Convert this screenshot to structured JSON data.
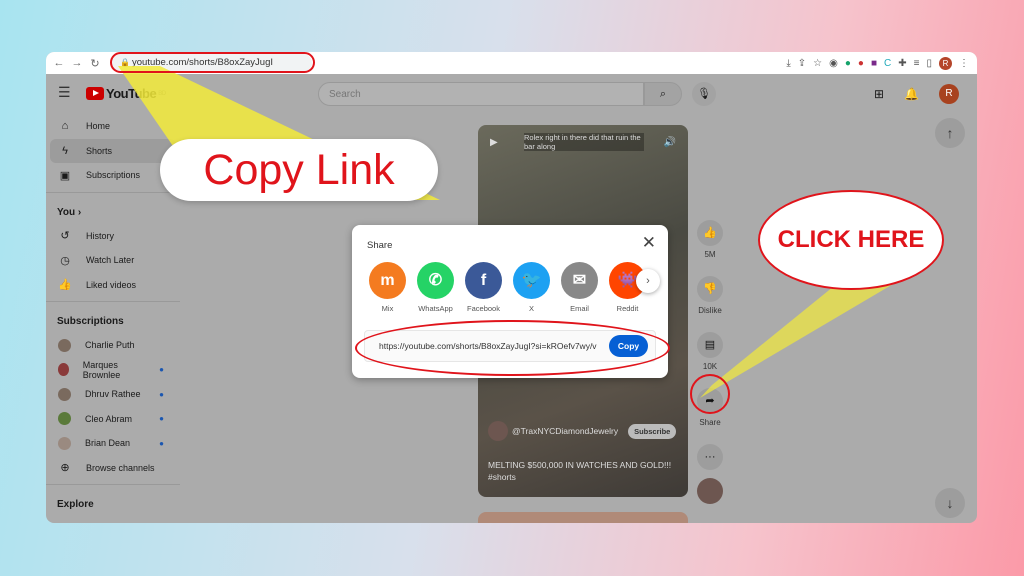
{
  "browser": {
    "url": "youtube.com/shorts/B8oxZayJugI",
    "profile_initial": "R"
  },
  "youtube": {
    "logo": "YouTube",
    "region": "BD",
    "search_placeholder": "Search",
    "avatar_initial": "R",
    "sidebar": {
      "main": [
        {
          "label": "Home",
          "icon": "home-icon"
        },
        {
          "label": "Shorts",
          "icon": "shorts-icon"
        },
        {
          "label": "Subscriptions",
          "icon": "subscriptions-icon"
        }
      ],
      "you_heading": "You",
      "you": [
        {
          "label": "History"
        },
        {
          "label": "Watch Later"
        },
        {
          "label": "Liked videos"
        }
      ],
      "subscriptions_heading": "Subscriptions",
      "subscriptions": [
        {
          "label": "Charlie Puth",
          "live": false
        },
        {
          "label": "Marques Brownlee",
          "live": true
        },
        {
          "label": "Dhruv Rathee",
          "live": true
        },
        {
          "label": "Cleo Abram",
          "live": true
        },
        {
          "label": "Brian Dean",
          "live": true
        }
      ],
      "browse_channels": "Browse channels",
      "explore_heading": "Explore"
    },
    "short": {
      "caption": "Rolex right in there did that ruin the bar along",
      "channel": "@TraxNYCDiamondJewelry",
      "subscribe": "Subscribe",
      "title": "MELTING $500,000 IN WATCHES AND GOLD!!! #shorts"
    },
    "actions": {
      "likes": "5M",
      "dislike": "Dislike",
      "comments": "10K",
      "share": "Share"
    }
  },
  "share_dialog": {
    "title": "Share",
    "targets": [
      {
        "label": "Mix",
        "color": "#f47b20"
      },
      {
        "label": "WhatsApp",
        "color": "#25d366"
      },
      {
        "label": "Facebook",
        "color": "#3b5998"
      },
      {
        "label": "X",
        "color": "#1da1f2"
      },
      {
        "label": "Email",
        "color": "#888888"
      },
      {
        "label": "Reddit",
        "color": "#ff4500"
      }
    ],
    "link": "https://youtube.com/shorts/B8oxZayJugI?si=kROefv7wy/v",
    "copy": "Copy"
  },
  "annotations": {
    "copy_link": "Copy Link",
    "click_here": "CLICK HERE",
    "color": "#e0141b"
  }
}
